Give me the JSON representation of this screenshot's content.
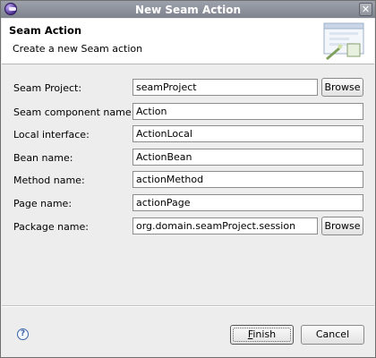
{
  "window": {
    "title": "New Seam Action"
  },
  "header": {
    "title": "Seam Action",
    "description": "Create a new Seam action"
  },
  "form": {
    "seam_project": {
      "label": "Seam Project:",
      "value": "seamProject"
    },
    "component_name": {
      "label": "Seam component name:",
      "value": "Action"
    },
    "local_interface": {
      "label": "Local interface:",
      "value": "ActionLocal"
    },
    "bean_name": {
      "label": "Bean name:",
      "value": "ActionBean"
    },
    "method_name": {
      "label": "Method name:",
      "value": "actionMethod"
    },
    "page_name": {
      "label": "Page name:",
      "value": "actionPage"
    },
    "package_name": {
      "label": "Package name:",
      "value": "org.domain.seamProject.session"
    },
    "browse_label": "Browse"
  },
  "footer": {
    "help_glyph": "?",
    "finish_prefix": "F",
    "finish_rest": "inish",
    "cancel_label": "Cancel"
  },
  "icons": {
    "app": "eclipse-icon",
    "close": "close-icon",
    "wizard": "wizard-banner-icon",
    "help": "help-icon"
  },
  "colors": {
    "titlebar": "#8a8e98",
    "accent": "#3b63a6"
  }
}
